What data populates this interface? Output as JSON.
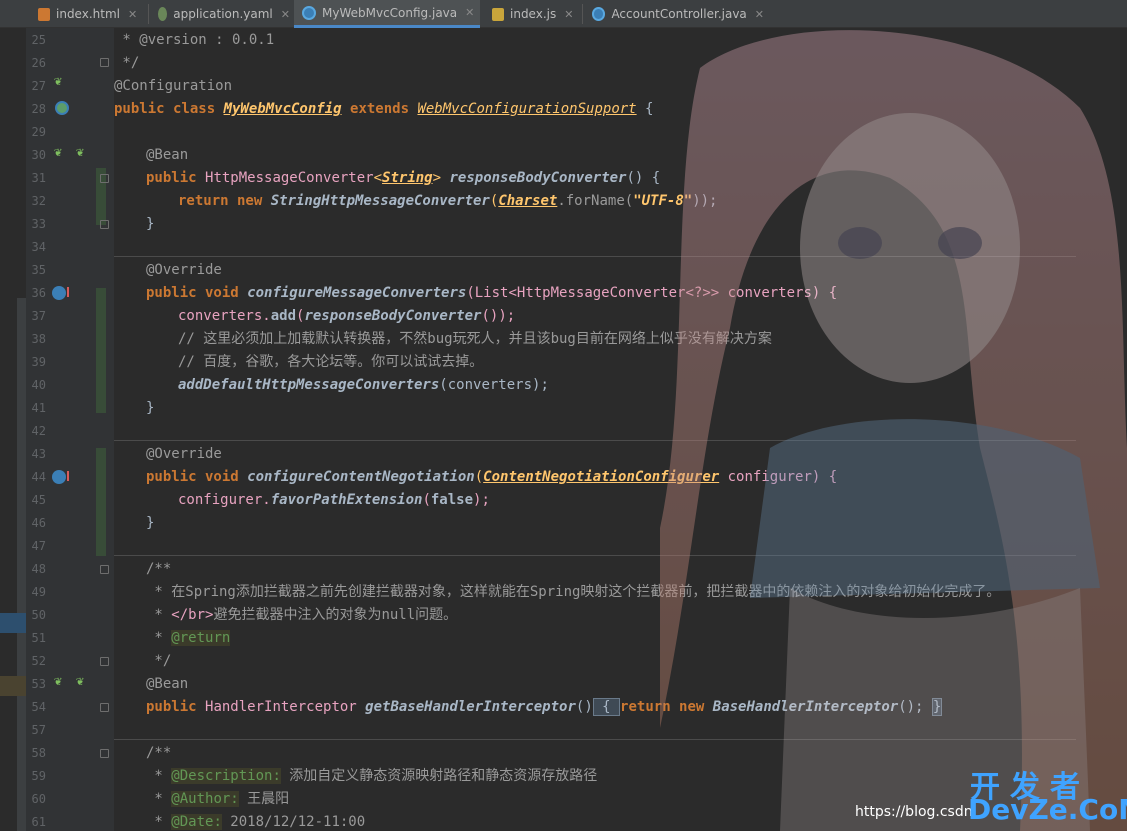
{
  "tabs": [
    {
      "label": "index.html",
      "icon": "html-file-icon",
      "active": false
    },
    {
      "label": "application.yaml",
      "icon": "yaml-file-icon",
      "active": false
    },
    {
      "label": "MyWebMvcConfig.java",
      "icon": "java-class-icon",
      "active": true
    },
    {
      "label": "index.js",
      "icon": "js-file-icon",
      "active": false
    },
    {
      "label": "AccountController.java",
      "icon": "java-class-icon",
      "active": false
    }
  ],
  "line_numbers": [
    "25",
    "26",
    "27",
    "28",
    "29",
    "30",
    "31",
    "32",
    "33",
    "34",
    "35",
    "36",
    "37",
    "38",
    "39",
    "40",
    "41",
    "42",
    "43",
    "44",
    "45",
    "46",
    "47",
    "48",
    "49",
    "50",
    "51",
    "52",
    "53",
    "54",
    "57",
    "58",
    "59",
    "60",
    "61"
  ],
  "code": {
    "l25": " * @version : 0.0.1",
    "l26": " */",
    "l27": "@Configuration",
    "l28_kw": "public class ",
    "l28_cls": "MyWebMvcConfig",
    "l28_ext": " extends ",
    "l28_sup": "WebMvcConfigurationSupport",
    "l28_end": " {",
    "l30": "@Bean",
    "l31_kw": "public ",
    "l31_t1": "HttpMessageConverter",
    "l31_lt": "<",
    "l31_s": "String",
    "l31_gt": ">",
    "l31_fn": " responseBodyConverter",
    "l31_end": "() {",
    "l32_kw": "return new ",
    "l32_c": "StringHttpMessageConverter",
    "l32_p": "(",
    "l32_cs": "Charset",
    "l32_m": ".forName(",
    "l32_str": "\"UTF-8\"",
    "l32_end": "));",
    "l33": "}",
    "l35": "@Override",
    "l36_kw": "public void ",
    "l36_fn": "configureMessageConverters",
    "l36_args": "(List<HttpMessageConverter<?>> converters) {",
    "l37_a": "converters.",
    "l37_b": "add",
    "l37_c": "(",
    "l37_d": "responseBodyConverter",
    "l37_e": "());",
    "l38": "// 这里必须加上加载默认转换器，不然bug玩死人，并且该bug目前在网络上似乎没有解决方案",
    "l39": "// 百度，谷歌，各大论坛等。你可以试试去掉。",
    "l40_fn": "addDefaultHttpMessageConverters",
    "l40_end": "(converters);",
    "l41": "}",
    "l43": "@Override",
    "l44_kw": "public void ",
    "l44_fn": "configureContentNegotiation",
    "l44_p": "(",
    "l44_t": "ContentNegotiationConfigurer",
    "l44_end": " configurer) {",
    "l45_a": "configurer.",
    "l45_b": "favorPathExtension",
    "l45_c": "(",
    "l45_d": "false",
    "l45_e": ");",
    "l46": "}",
    "l48": "/**",
    "l49": " * 在Spring添加拦截器之前先创建拦截器对象，这样就能在Spring映射这个拦截器前，把拦截器中的依赖注入的对象给初始化完成了。",
    "l50_a": " * ",
    "l50_tag": "</br>",
    "l50_b": "避免拦截器中注入的对象为null问题。",
    "l51_a": " * ",
    "l51_tag": "@return",
    "l52": " */",
    "l53": "@Bean",
    "l54_kw": "public ",
    "l54_t": "HandlerInterceptor",
    "l54_fn": " getBaseHandlerInterceptor",
    "l54_p": "()",
    "l54_b1": " { ",
    "l54_kw2": "return new ",
    "l54_c": "BaseHandlerInterceptor",
    "l54_e": "(); ",
    "l54_b2": "}",
    "l58": "/**",
    "l59_a": " * ",
    "l59_tag": "@Description:",
    "l59_b": " 添加自定义静态资源映射路径和静态资源存放路径",
    "l60_a": " * ",
    "l60_tag": "@Author:",
    "l60_b": " 王晨阳",
    "l61_a": " * ",
    "l61_tag": "@Date:",
    "l61_b": " 2018/12/12-11:00"
  },
  "watermark": {
    "url": "https://blog.csdn",
    "cn": "开发者",
    "en": "DevZe.CoM"
  },
  "colors": {
    "background": "#2b2b2b",
    "keyword": "#cc7832",
    "annotation": "#bbb529",
    "method": "#ffc66d",
    "string": "#6a8759",
    "comment": "#808080",
    "accent": "#4a88c7"
  }
}
